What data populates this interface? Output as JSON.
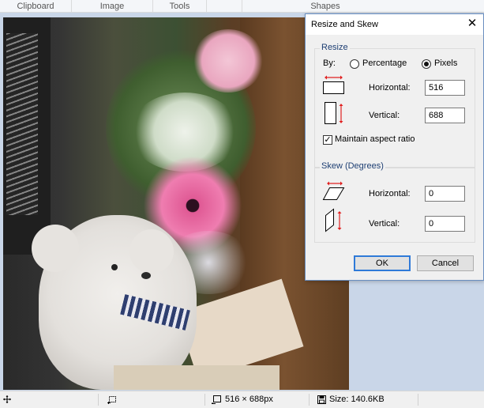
{
  "ribbon": {
    "groups": [
      "Clipboard",
      "Image",
      "Tools",
      "Shapes"
    ]
  },
  "status": {
    "dimensions": "516 × 688px",
    "size": "Size: 140.6KB"
  },
  "dialog": {
    "title": "Resize and Skew",
    "close_glyph": "✕",
    "resize": {
      "section_title": "Resize",
      "by_label": "By:",
      "options": [
        "Percentage",
        "Pixels"
      ],
      "selected": "Pixels",
      "horizontal_label": "Horizontal:",
      "horizontal_value": "516",
      "vertical_label": "Vertical:",
      "vertical_value": "688",
      "aspect_label": "Maintain aspect ratio",
      "aspect_checked": true
    },
    "skew": {
      "section_title": "Skew (Degrees)",
      "horizontal_label": "Horizontal:",
      "horizontal_value": "0",
      "vertical_label": "Vertical:",
      "vertical_value": "0"
    },
    "ok_label": "OK",
    "cancel_label": "Cancel"
  },
  "colors": {
    "accent_arrow": "#e02020",
    "default_button_border": "#2f7ad8",
    "section_title": "#1e3f73"
  }
}
